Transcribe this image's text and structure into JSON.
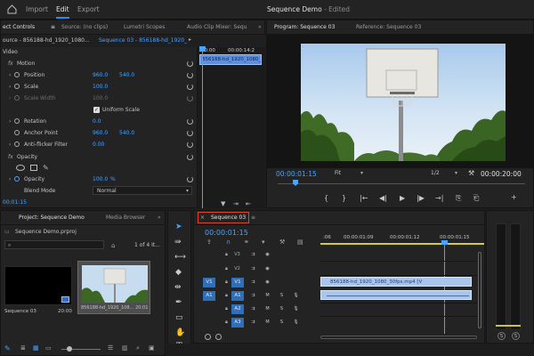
{
  "menu": {
    "home_icon": "home-icon",
    "items": [
      {
        "label": "Import",
        "active": false
      },
      {
        "label": "Edit",
        "active": true
      },
      {
        "label": "Export",
        "active": false
      }
    ],
    "document_title": "Sequence Demo",
    "document_status": "- Edited"
  },
  "effect_panel": {
    "tabs": [
      "ect Controls",
      "Source: (no clips)",
      "Lumetri Scopes",
      "Audio Clip Mixer: Sequ"
    ],
    "menu_icon": "≡",
    "more_icon": "»",
    "source_label": "ource - 856188-hd_1920_1080...",
    "sequence_label": "Sequence 03 - 856188-hd_1920_",
    "mini_timecode_start": "00:00",
    "mini_timecode_end": "00:00:14:2",
    "mini_clip_label": "856188-hd_1920_1080_",
    "section_video": "Video",
    "motion": "Motion",
    "position_label": "Position",
    "position_x": "960.0",
    "position_y": "540.0",
    "scale_label": "Scale",
    "scale_value": "100.0",
    "scale_width_label": "Scale Width",
    "scale_width_value": "100.0",
    "uniform_scale_label": "Uniform Scale",
    "rotation_label": "Rotation",
    "rotation_value": "0.0",
    "anchor_label": "Anchor Point",
    "anchor_x": "960.0",
    "anchor_y": "540.0",
    "antiflicker_label": "Anti-flicker Filter",
    "antiflicker_value": "0.00",
    "opacity_section": "Opacity",
    "opacity_label": "Opacity",
    "opacity_value": "100.0",
    "opacity_unit": "%",
    "blend_label": "Blend Mode",
    "blend_value": "Normal",
    "bottom_timecode": "00:01:15"
  },
  "program": {
    "tab_active": "Program: Sequence 03",
    "tab_reference": "Reference: Sequence 03",
    "timecode": "00:00:01:15",
    "fit_label": "Fit",
    "resolution": "1/2",
    "duration": "00:00:20:00",
    "wrench_icon": "wrench-icon",
    "controls": [
      "{",
      "}",
      "|←",
      "◀|",
      "▶",
      "|▶",
      "→|",
      "⎘",
      "⎗",
      "+"
    ]
  },
  "project": {
    "tab_project": "Project: Sequence Demo",
    "tab_media": "Media Browser",
    "more": "»",
    "project_file": "Sequence Demo.prproj",
    "search_placeholder": "",
    "item_count": "1 of 4 It...",
    "item1_name": "Sequence 03",
    "item1_duration": "20:00",
    "item2_name": "856188-hd_1920_108...",
    "item2_duration": "20:01"
  },
  "tools": {
    "icons": [
      "selection-tool-icon",
      "track-select-icon",
      "ripple-edit-icon",
      "razor-icon",
      "slip-icon",
      "pen-icon",
      "rectangle-icon",
      "hand-icon",
      "type-icon"
    ]
  },
  "timeline": {
    "tab_close": "×",
    "tab_label": "Sequence 03",
    "tab_menu": "≡",
    "timecode": "00:00:01:15",
    "ruler_labels": [
      ":06",
      "00:00:01:09",
      "00:00:01:12",
      "00:00:01:15"
    ],
    "tracks": [
      {
        "src": "",
        "name": "V3",
        "type": "video"
      },
      {
        "src": "",
        "name": "V2",
        "type": "video"
      },
      {
        "src": "V1",
        "name": "V1",
        "type": "video"
      },
      {
        "src": "A1",
        "name": "A1",
        "type": "audio"
      },
      {
        "src": "",
        "name": "A2",
        "type": "audio"
      },
      {
        "src": "",
        "name": "A3",
        "type": "audio"
      }
    ],
    "track_m": "M",
    "track_s": "S",
    "video_clip_label": "856188-hd_1920_1080_30fps.mp4 [V",
    "zoom_icon": "zoom-icon"
  },
  "meter": {
    "left_label": "S",
    "right_label": "S"
  }
}
